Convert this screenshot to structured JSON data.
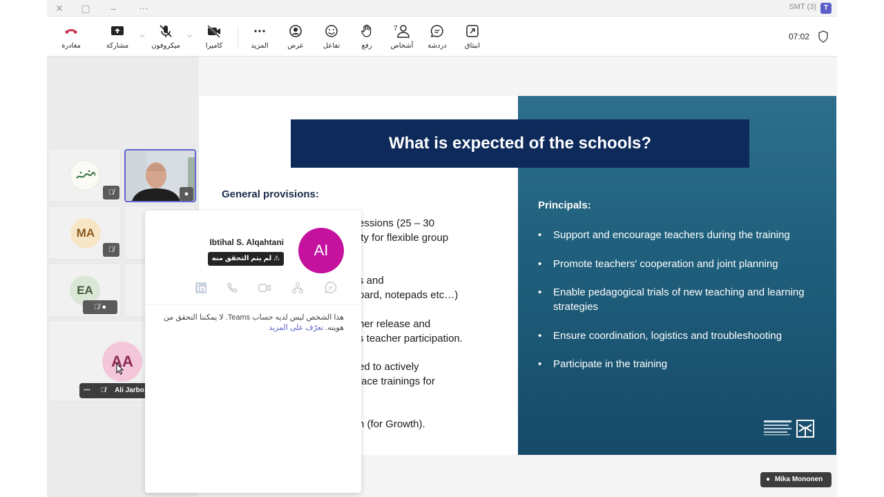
{
  "window": {
    "title": "SMT (3)",
    "controls": [
      "close-icon",
      "maximize-icon",
      "minimize-icon",
      "more-icon"
    ]
  },
  "toolbar": {
    "leave_label": "مغادرة",
    "share_label": "مشاركة",
    "mic_label": "ميكروفون",
    "camera_label": "كاميرا",
    "more_label": "المزيد",
    "view_label": "عرض",
    "react_label": "تفاعل",
    "raise_label": "رفع",
    "people_label": "أشخاص",
    "people_count": "7",
    "chat_label": "دردشة",
    "popout_label": "انبثاق",
    "clock": "07:02",
    "colors": {
      "leave": "#c4314b",
      "accent": "#5b5fc7"
    }
  },
  "gallery": {
    "tiles": [
      {
        "initials": "MA",
        "avatar_color": "#f7e6c6",
        "text_color": "#8a5a20"
      },
      {
        "initials": "EA",
        "avatar_color": "#dbe7d6",
        "text_color": "#3e5a3a"
      },
      {
        "initials": "AA",
        "avatar_color": "#f4c6d9",
        "text_color": "#8a2a55",
        "name": "Ali Jarbo"
      }
    ]
  },
  "slide": {
    "title": "What is expected of the schools?",
    "general_title": "General provisions:",
    "fragments": [
      "essions (25 – 30",
      "ity for flexible group",
      "s and",
      "oard, notepads etc…)",
      "her release and",
      "s teacher participation.",
      "ed to actively",
      "face trainings for",
      "n (for Growth)."
    ],
    "principals_title": "Principals:",
    "bullets": [
      "Support and encourage teachers during the training",
      "Promote  teachers' cooperation and joint planning",
      "Enable pedagogical trials of new teaching and learning strategies",
      "Ensure coordination, logistics and troubleshooting",
      "Participate in the training"
    ],
    "colors": {
      "title_bar": "#0d2a5b",
      "right_panel": "#1f5f7c"
    }
  },
  "card": {
    "name": "Ibtihal S. Alqahtani",
    "initials": "AI",
    "badge": "لم يتم التحقق منه",
    "message": "هذا الشخص ليس لديه حساب Teams. لا يمكننا التحقق من هويته.",
    "learn_more": "تعرّف على المزيد",
    "icons": [
      "linkedin-icon",
      "call-icon",
      "video-icon",
      "org-chart-icon",
      "chat-icon"
    ],
    "avatar_color": "#c4119e"
  },
  "presenter_pill": {
    "name": "Mika Mononen"
  }
}
